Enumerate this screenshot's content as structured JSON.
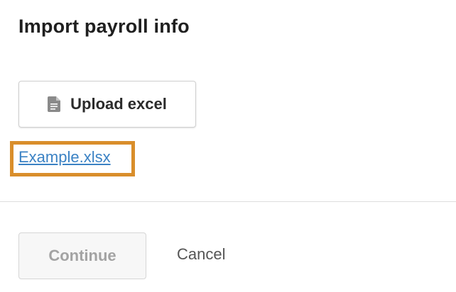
{
  "dialog": {
    "title": "Import payroll info"
  },
  "upload": {
    "label": "Upload excel",
    "icon": "document-icon"
  },
  "example": {
    "link_text": "Example.xlsx",
    "highlight_color": "#d98e2b",
    "link_color": "#3b82c4"
  },
  "footer": {
    "continue_label": "Continue",
    "cancel_label": "Cancel"
  }
}
